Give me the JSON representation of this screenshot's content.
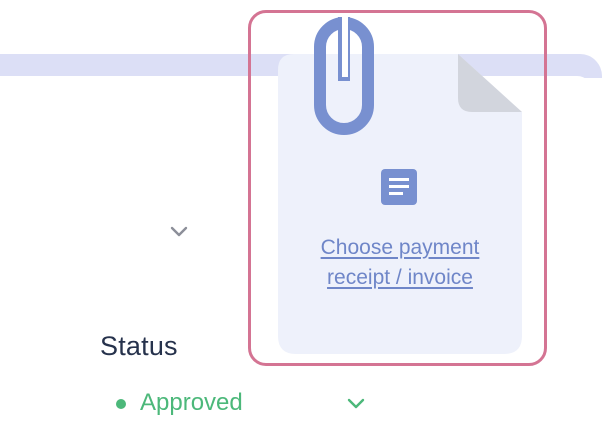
{
  "upload": {
    "link_label_line1": "Choose payment",
    "link_label_line2": "receipt / invoice",
    "icons": [
      "paperclip-icon",
      "document-icon"
    ]
  },
  "status": {
    "label": "Status",
    "value": "Approved"
  },
  "colors": {
    "accent": "#7890d0",
    "link": "#6f86c8",
    "status_approved": "#4cb87a",
    "highlight": "#d47493",
    "doc_background": "#eef1fb",
    "band": "#dcdff6",
    "heading": "#26324c"
  }
}
